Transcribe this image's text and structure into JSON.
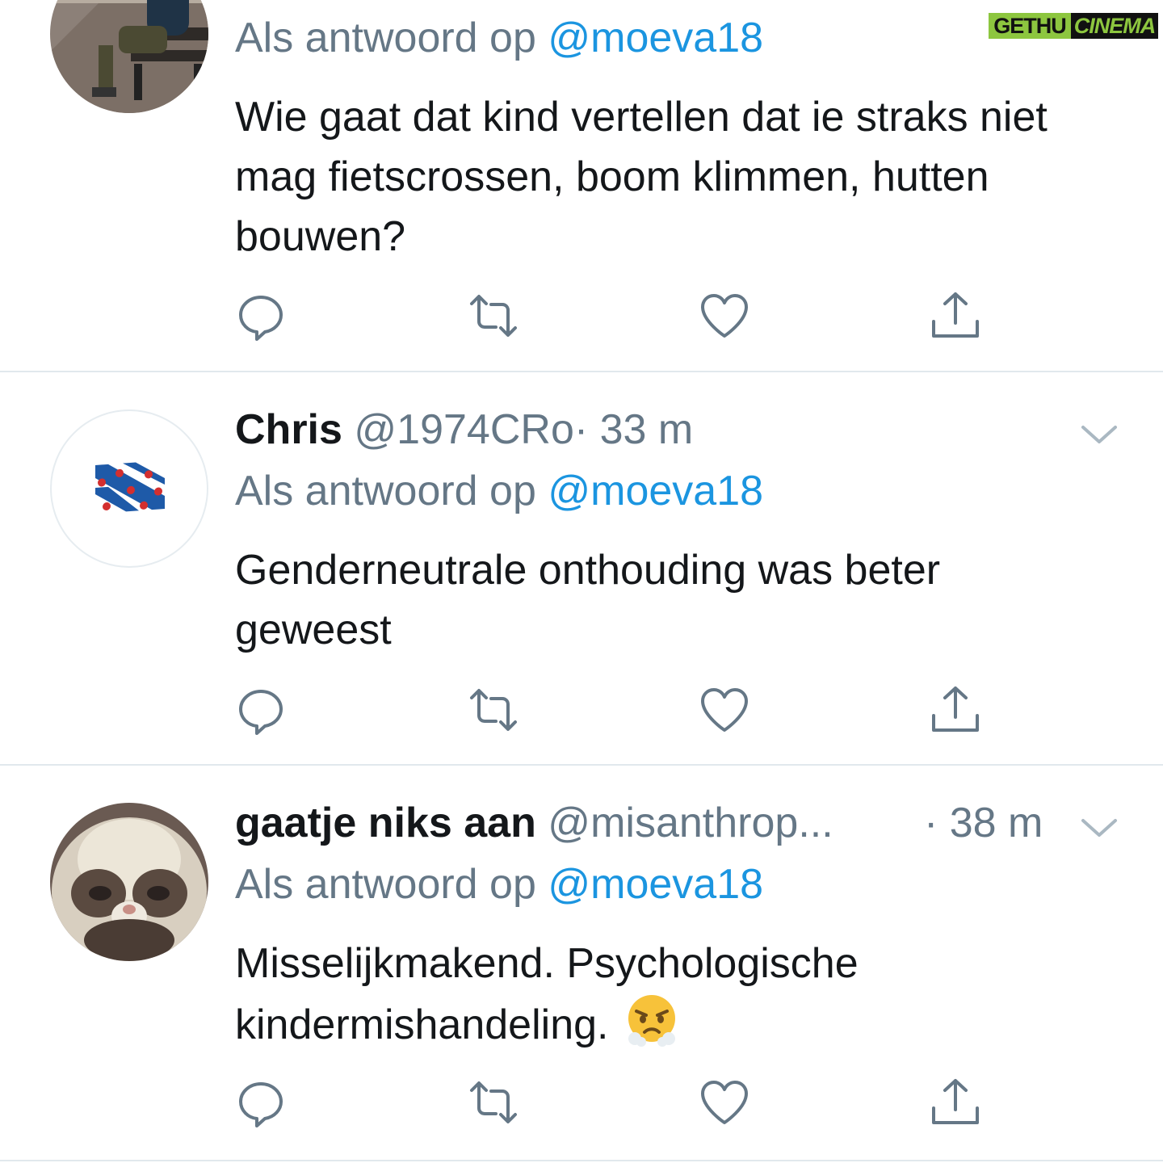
{
  "watermark": {
    "left": "GETHU",
    "right": "CINEMA"
  },
  "reply_prefix": "Als antwoord op",
  "tweets": [
    {
      "reply_to": "@moeva18",
      "text": "Wie gaat dat kind vertellen dat ie straks niet mag fietscrossen, boom klimmen, hutten bouwen?"
    },
    {
      "name": "Chris",
      "handle": "@1974CRo",
      "time": "· 33 m",
      "reply_to": "@moeva18",
      "text": "Genderneutrale onthouding was beter geweest"
    },
    {
      "name": "gaatje niks aan",
      "handle": "@misanthrop...",
      "time": "· 38 m",
      "reply_to": "@moeva18",
      "text": "Misselijkmakend. Psychologische kindermishandeling.",
      "emoji": "face-with-steam-from-nose"
    }
  ],
  "colors": {
    "accent": "#1b95e0",
    "secondary": "#657786",
    "divider": "#e1e8ed",
    "icon": "#657786"
  }
}
